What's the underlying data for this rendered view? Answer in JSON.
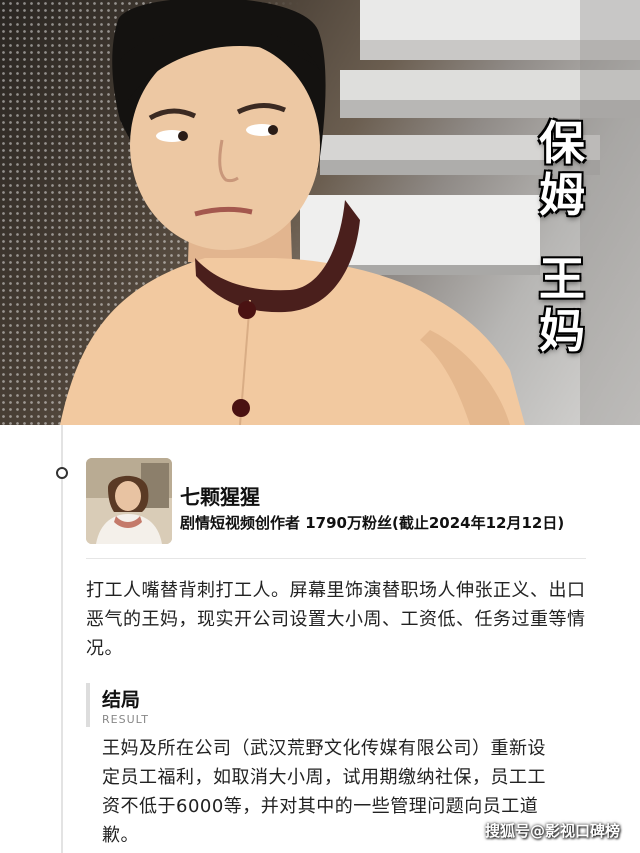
{
  "hero": {
    "title_chars": [
      "保",
      "姆",
      "王",
      "妈"
    ]
  },
  "creator": {
    "name": "七颗猩猩",
    "meta": "剧情短视频创作者 1790万粉丝(截止2024年12月12日)"
  },
  "description": "打工人嘴替背刺打工人。屏幕里饰演替职场人伸张正义、出口恶气的王妈，现实开公司设置大小周、工资低、任务过重等情况。",
  "result": {
    "title": "结局",
    "subtitle": "RESULT",
    "text": "王妈及所在公司（武汉荒野文化传媒有限公司）重新设定员工福利，如取消大小周，试用期缴纳社保，员工工资不低于6000等，并对其中的一些管理问题向员工道歉。"
  },
  "watermark": "搜狐号@影视口碑榜",
  "colors": {
    "uniform": "#f2c9a0",
    "collar": "#4a1f1c",
    "buttons": "#4a1212"
  }
}
